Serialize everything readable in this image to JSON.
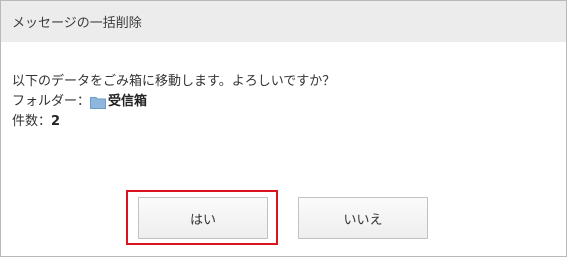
{
  "dialog": {
    "title": "メッセージの一括削除",
    "message": "以下のデータをごみ箱に移動します。よろしいですか？",
    "folder_label": "フォルダー：",
    "folder_icon": "folder-icon",
    "folder_name": "受信箱",
    "count_label": "件数：",
    "count_value": "2",
    "yes_label": "はい",
    "no_label": "いいえ"
  },
  "colors": {
    "header_bg": "#ececec",
    "highlight_border": "#d9141e",
    "folder_icon": "#8fb6dd"
  }
}
